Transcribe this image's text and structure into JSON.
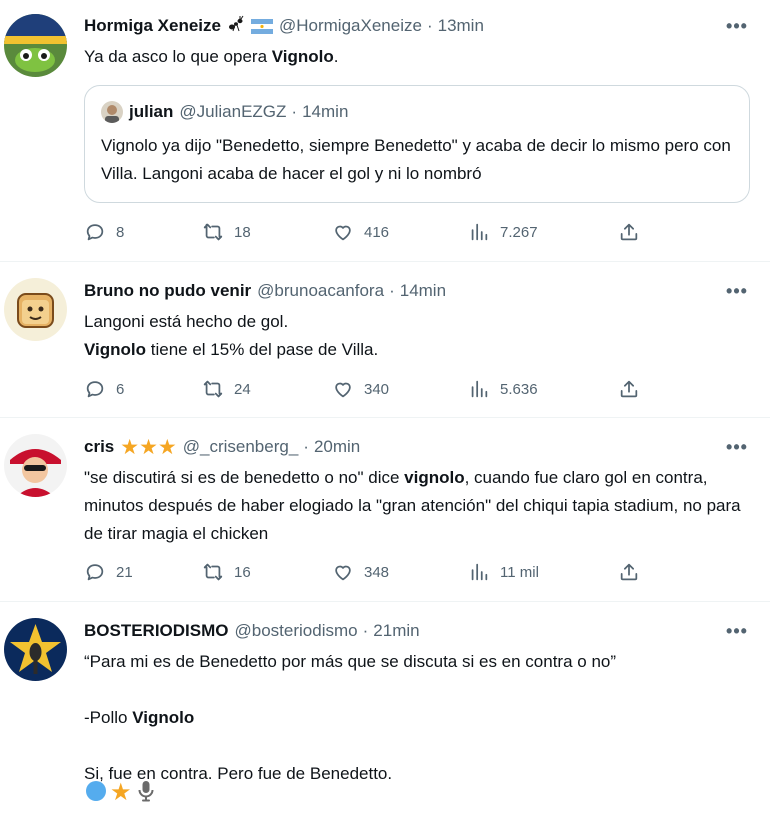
{
  "tweets": [
    {
      "name": "Hormiga Xeneize",
      "handle": "@HormigaXeneize",
      "dot": "·",
      "time": "13min",
      "text_pre": "Ya da asco lo que opera ",
      "text_bold": "Vignolo",
      "text_post": ".",
      "quote": {
        "name": "julian",
        "handle": "@JulianEZGZ",
        "dot": "·",
        "time": "14min",
        "text": "Vignolo ya dijo \"Benedetto, siempre Benedetto\" y acaba de decir lo mismo pero con Villa. Langoni acaba de hacer el gol y ni lo nombró"
      },
      "replies": "8",
      "retweets": "18",
      "likes": "416",
      "views": "7.267"
    },
    {
      "name": "Bruno no pudo venir",
      "handle": "@brunoacanfora",
      "dot": "·",
      "time": "14min",
      "line1": "Langoni está hecho de gol.",
      "line2_bold": "Vignolo",
      "line2_post": " tiene el 15% del pase de Villa.",
      "replies": "6",
      "retweets": "24",
      "likes": "340",
      "views": "5.636"
    },
    {
      "name": "cris",
      "handle": "@_crisenberg_",
      "dot": "·",
      "time": "20min",
      "text_pre": "\"se discutirá si es de benedetto o no\" dice ",
      "text_bold": "vignolo",
      "text_post": ", cuando fue claro gol en contra, minutos después de haber elogiado la \"gran atención\" del chiqui tapia stadium, no para de tirar magia el chicken",
      "replies": "21",
      "retweets": "16",
      "likes": "348",
      "views": "11 mil"
    },
    {
      "name": "BOSTERIODISMO",
      "handle": "@bosteriodismo",
      "dot": "·",
      "time": "21min",
      "p1": "“Para mi es de Benedetto por más que se discuta si es en contra o no”",
      "p2_pre": "-Pollo ",
      "p2_bold": "Vignolo",
      "p3": "Si, fue en contra. Pero fue de Benedetto."
    }
  ],
  "icons": {
    "more": "more-icon",
    "reply": "reply-icon",
    "retweet": "retweet-icon",
    "like": "heart-icon",
    "views": "views-icon",
    "share": "share-icon"
  },
  "colors": {
    "text": "#0f1419",
    "secondary": "#536471",
    "divider": "#eff3f4",
    "quote_border": "#cfd9de",
    "star": "#f5a623",
    "blue_circle": "#55acee"
  },
  "more_label": "•••"
}
